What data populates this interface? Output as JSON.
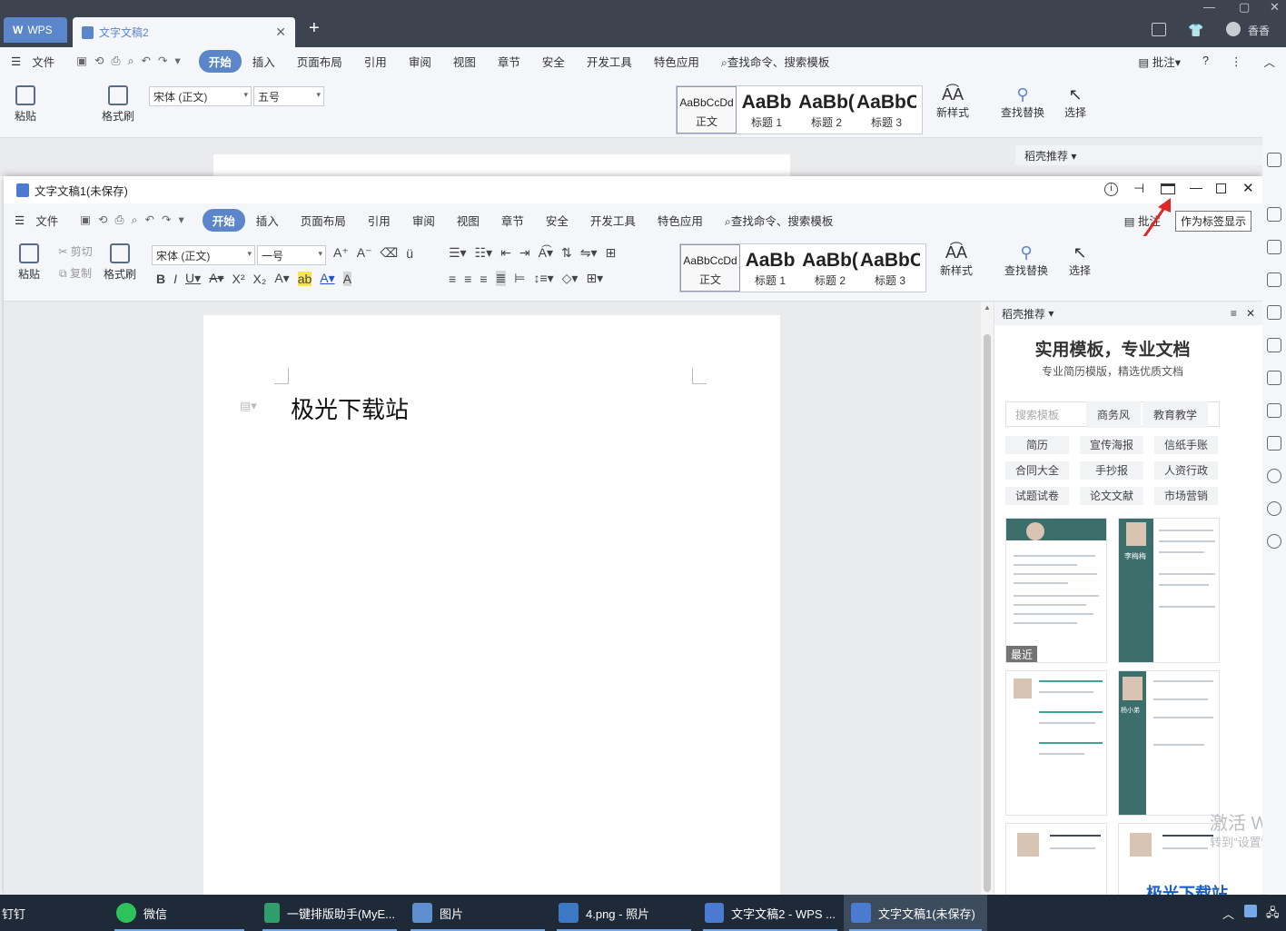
{
  "app_name": "WPS",
  "back": {
    "tab_title": "文字文稿2",
    "top_right_user": "香香",
    "menu": {
      "file": "文件",
      "items": [
        "开始",
        "插入",
        "页面布局",
        "引用",
        "审阅",
        "视图",
        "章节",
        "安全",
        "开发工具",
        "特色应用"
      ],
      "search": "查找命令、搜索模板",
      "comment": "批注"
    },
    "panel_title": "稻壳推荐"
  },
  "front": {
    "title": "文字文稿1(未保存)",
    "menu": {
      "file": "文件",
      "items": [
        "开始",
        "插入",
        "页面布局",
        "引用",
        "审阅",
        "视图",
        "章节",
        "安全",
        "开发工具",
        "特色应用"
      ],
      "search": "查找命令、搜索模板",
      "comment": "批注"
    },
    "tooltip": "作为标签显示",
    "ribbon": {
      "paste": "粘贴",
      "cut": "剪切",
      "copy": "复制",
      "format_painter": "格式刷",
      "font": "宋体 (正文)",
      "size": "一号",
      "styles": [
        {
          "sample": "AaBbCcDd",
          "name": "正文"
        },
        {
          "sample": "AaBb",
          "name": "标题 1"
        },
        {
          "sample": "AaBb(",
          "name": "标题 2"
        },
        {
          "sample": "AaBbC(",
          "name": "标题 3"
        }
      ],
      "new_style": "新样式",
      "find_replace": "查找替换",
      "select": "选择"
    },
    "document_text": "极光下载站",
    "panel": {
      "title": "稻壳推荐",
      "heading": "实用模板，专业文档",
      "subheading": "专业简历模版，精选优质文档",
      "search_placeholder": "搜索模板",
      "search_tabs": [
        "商务风",
        "教育教学"
      ],
      "tags": [
        "简历",
        "宣传海报",
        "信纸手账",
        "合同大全",
        "手抄报",
        "人资行政",
        "试题试卷",
        "论文文献",
        "市场营销"
      ],
      "recent_label": "最近",
      "template_names": [
        "李梅梅",
        "杨小弟"
      ]
    }
  },
  "back_ribbon": {
    "font": "宋体 (正文)",
    "size": "五号"
  },
  "watermark": {
    "line1": "激活 Win",
    "line2": "转到\"设置\"以"
  },
  "brand": "极光下载站",
  "taskbar": {
    "items": [
      "钉钉",
      "微信",
      "一键排版助手(MyE...",
      "图片",
      "4.png - 照片",
      "文字文稿2 - WPS ...",
      "文字文稿1(未保存)"
    ]
  }
}
